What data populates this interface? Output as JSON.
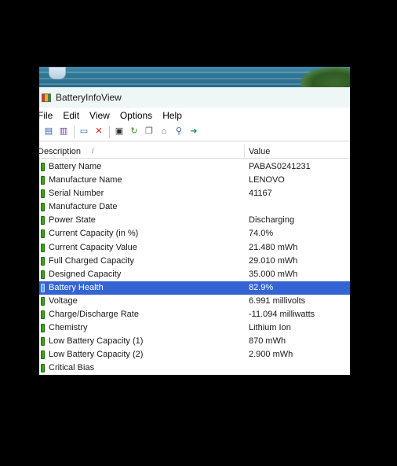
{
  "window": {
    "title": "BatteryInfoView"
  },
  "menu": [
    "File",
    "Edit",
    "View",
    "Options",
    "Help"
  ],
  "toolbar": [
    {
      "name": "properties-list-icon",
      "glyph": "▤",
      "color": "#2a5caa"
    },
    {
      "name": "clipboard-icon",
      "glyph": "▥",
      "color": "#6a3fa0"
    },
    {
      "name": "window-icon",
      "glyph": "▭",
      "color": "#2a5caa"
    },
    {
      "name": "delete-icon",
      "glyph": "✕",
      "color": "#d0201a"
    },
    {
      "name": "save-icon",
      "glyph": "▣",
      "color": "#2b2b2b"
    },
    {
      "name": "refresh-icon",
      "glyph": "↻",
      "color": "#3a8a2a"
    },
    {
      "name": "copy-icon",
      "glyph": "❐",
      "color": "#5a5a5a"
    },
    {
      "name": "html-report-icon",
      "glyph": "⌂",
      "color": "#5a5a5a"
    },
    {
      "name": "find-icon",
      "glyph": "⚲",
      "color": "#2a5caa"
    },
    {
      "name": "exit-icon",
      "glyph": "➜",
      "color": "#1a8a6a"
    }
  ],
  "columns": {
    "description": "Description",
    "value": "Value",
    "sort": "/"
  },
  "rows": [
    {
      "label": "Battery Name",
      "value": "PABAS0241231"
    },
    {
      "label": "Manufacture Name",
      "value": "LENOVO"
    },
    {
      "label": "Serial Number",
      "value": "41167"
    },
    {
      "label": "Manufacture Date",
      "value": ""
    },
    {
      "label": "Power State",
      "value": "Discharging"
    },
    {
      "label": "Current Capacity (in %)",
      "value": "74.0%"
    },
    {
      "label": "Current Capacity Value",
      "value": "21.480 mWh"
    },
    {
      "label": "Full Charged Capacity",
      "value": "29.010 mWh"
    },
    {
      "label": "Designed Capacity",
      "value": "35.000 mWh"
    },
    {
      "label": "Battery Health",
      "value": "82.9%",
      "selected": true
    },
    {
      "label": "Voltage",
      "value": "6.991 millivolts"
    },
    {
      "label": "Charge/Discharge Rate",
      "value": "-11.094 milliwatts"
    },
    {
      "label": "Chemistry",
      "value": "Lithium Ion"
    },
    {
      "label": "Low Battery Capacity (1)",
      "value": "870 mWh"
    },
    {
      "label": "Low Battery Capacity (2)",
      "value": "2.900 mWh"
    },
    {
      "label": "Critical Bias",
      "value": ""
    }
  ],
  "colors": {
    "selection": "#3464d4",
    "battery": "#3f9e1e",
    "titlebar": "#eef7f5"
  }
}
